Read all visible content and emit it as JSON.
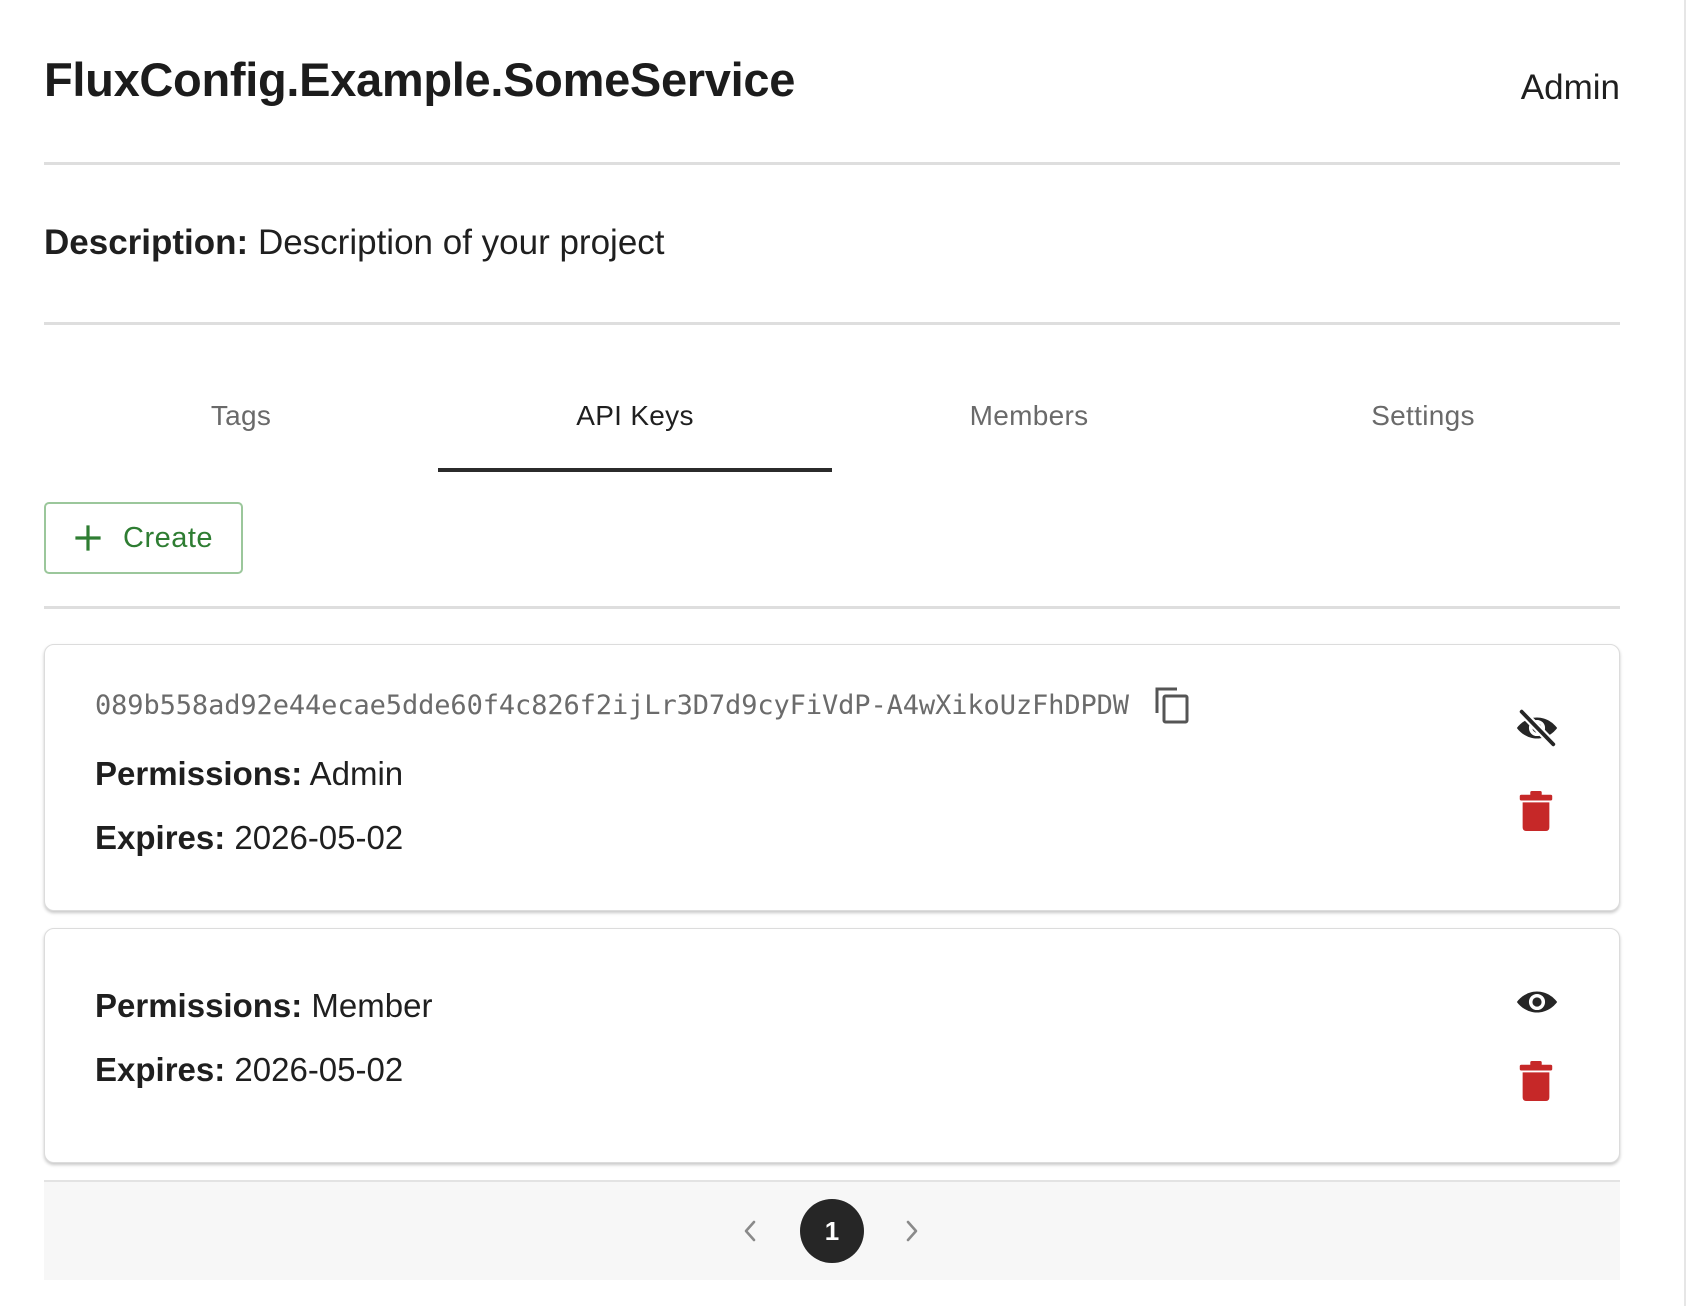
{
  "header": {
    "title": "FluxConfig.Example.SomeService",
    "user_role": "Admin"
  },
  "description": {
    "label": "Description:",
    "value": "Description of your project"
  },
  "tabs": [
    {
      "label": "Tags",
      "active": false
    },
    {
      "label": "API Keys",
      "active": true
    },
    {
      "label": "Members",
      "active": false
    },
    {
      "label": "Settings",
      "active": false
    }
  ],
  "toolbar": {
    "create_label": "Create"
  },
  "api_keys": [
    {
      "key": "089b558ad92e44ecae5dde60f4c826f2ijLr3D7d9cyFiVdP-A4wXikoUzFhDPDW",
      "key_visible": true,
      "visibility_icon": "eye-off-icon",
      "permissions_label": "Permissions:",
      "permissions": "Admin",
      "expires_label": "Expires:",
      "expires": "2026-05-02"
    },
    {
      "key": "",
      "key_visible": false,
      "visibility_icon": "eye-icon",
      "permissions_label": "Permissions:",
      "permissions": "Member",
      "expires_label": "Expires:",
      "expires": "2026-05-02"
    }
  ],
  "pagination": {
    "current_page": "1"
  },
  "icons": {
    "create": "plus-icon",
    "copy": "copy-icon",
    "delete": "trash-icon",
    "prev": "chevron-left-icon",
    "next": "chevron-right-icon"
  },
  "colors": {
    "accent_green": "#2e7d32",
    "create_border": "#9bc79b",
    "delete_red": "#c62828",
    "active_tab_underline": "#2b2b2b",
    "current_page_bg": "#262626"
  }
}
